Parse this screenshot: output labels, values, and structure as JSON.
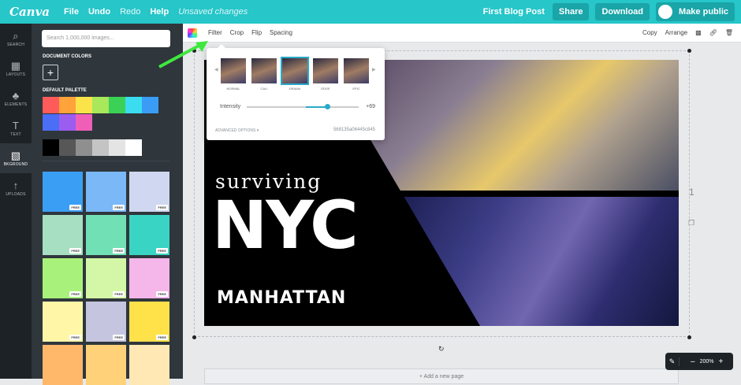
{
  "topbar": {
    "logo": "Canva",
    "menu": [
      "File",
      "Undo",
      "Redo",
      "Help"
    ],
    "status": "Unsaved changes",
    "doc_title": "First Blog Post",
    "share": "Share",
    "download": "Download",
    "make_public": "Make public"
  },
  "rail": [
    {
      "icon": "search-icon",
      "glyph": "⌕",
      "label": "SEARCH"
    },
    {
      "icon": "layouts-icon",
      "glyph": "▦",
      "label": "LAYOUTS"
    },
    {
      "icon": "elements-icon",
      "glyph": "♣",
      "label": "ELEMENTS"
    },
    {
      "icon": "text-icon",
      "glyph": "T",
      "label": "TEXT"
    },
    {
      "icon": "background-icon",
      "glyph": "▧",
      "label": "BKGROUND"
    },
    {
      "icon": "uploads-icon",
      "glyph": "↑",
      "label": "UPLOADS"
    }
  ],
  "panel": {
    "search_placeholder": "Search 1,000,000 images...",
    "doc_colors_label": "DOCUMENT COLORS",
    "add_color": "+",
    "default_palette_label": "DEFAULT PALETTE",
    "palette_row1": [
      "#ff5b5b",
      "#ffa33a",
      "#fbe34a",
      "#a8e85a",
      "#3bd157",
      "#3cdcf0",
      "#3a9cf5"
    ],
    "palette_row2": [
      "#4a6ef5",
      "#9b5cf0",
      "#ef5fb8"
    ],
    "grays": [
      "#000000",
      "#575757",
      "#8f8f8f",
      "#c4c4c4",
      "#e4e4e4",
      "#ffffff"
    ],
    "free_label": "FREE",
    "tiles": [
      "#3b9ef5",
      "#7ab8f7",
      "#cfd8f0",
      "#a6dfc1",
      "#71e0b5",
      "#39d4c3",
      "#a8f27b",
      "#d3f7a6",
      "#f5b6ea",
      "#fff6a8",
      "#c5c5df",
      "#ffe14a",
      "#ffb76a",
      "#ffd27a",
      "#ffe8b4"
    ]
  },
  "toolbar": {
    "filter": "Filter",
    "crop": "Crop",
    "flip": "Flip",
    "spacing": "Spacing",
    "copy": "Copy",
    "arrange": "Arrange"
  },
  "filter_popup": {
    "filters": [
      "NORMAL",
      "CALI",
      "DRAMA",
      "EDGE",
      "EPIC"
    ],
    "selected": "DRAMA",
    "intensity_label": "Intensity",
    "intensity_value": "+69",
    "intensity_fraction": 0.69,
    "advanced": "ADVANCED OPTIONS ▾",
    "filter_id": "568135a06445c845"
  },
  "design": {
    "line1": "surviving",
    "line2": "NYC",
    "line3": "MANHATTAN"
  },
  "page_number": "1",
  "add_page": "+ Add a new page",
  "zoom": {
    "level": "200%",
    "minus": "–",
    "plus": "+"
  }
}
